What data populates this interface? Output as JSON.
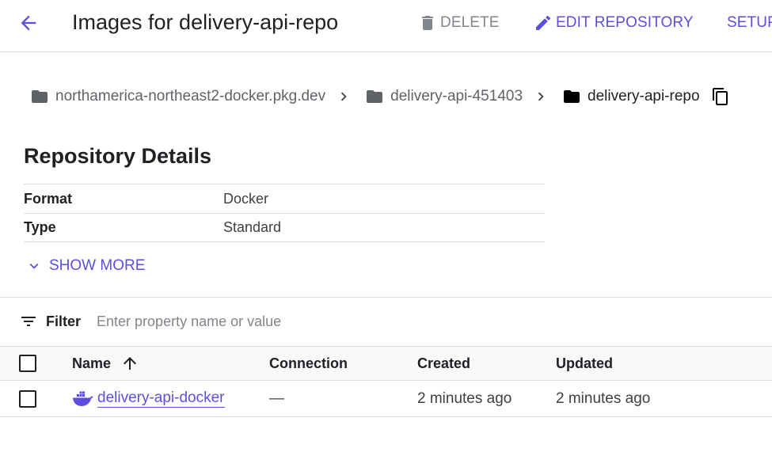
{
  "header": {
    "title": "Images for delivery-api-repo",
    "actions": {
      "delete": "DELETE",
      "edit": "EDIT REPOSITORY",
      "setup": "SETUP"
    }
  },
  "breadcrumb": [
    {
      "label": "northamerica-northeast2-docker.pkg.dev",
      "icon": "folder-icon"
    },
    {
      "label": "delivery-api-451403",
      "icon": "folder-icon"
    },
    {
      "label": "delivery-api-repo",
      "icon": "folder-icon"
    }
  ],
  "details": {
    "title": "Repository Details",
    "rows": [
      {
        "key": "Format",
        "value": "Docker"
      },
      {
        "key": "Type",
        "value": "Standard"
      }
    ],
    "show_more": "SHOW MORE"
  },
  "filter": {
    "label": "Filter",
    "placeholder": "Enter property name or value"
  },
  "table": {
    "columns": {
      "name": "Name",
      "connection": "Connection",
      "created": "Created",
      "updated": "Updated"
    },
    "rows": [
      {
        "name": "delivery-api-docker",
        "connection": "—",
        "created": "2 minutes ago",
        "updated": "2 minutes ago"
      }
    ]
  },
  "colors": {
    "accent": "#5e4ee0",
    "muted": "#80868b",
    "text": "#202124",
    "border": "#dadce0"
  }
}
